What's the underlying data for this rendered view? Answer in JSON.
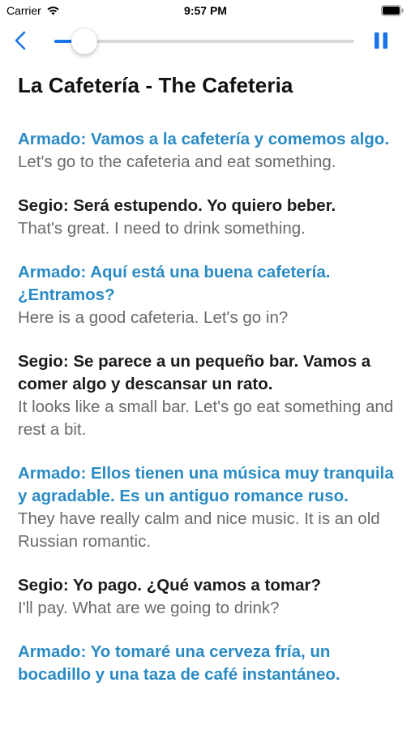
{
  "status_bar": {
    "carrier": "Carrier",
    "time": "9:57 PM",
    "wifi_icon": "wifi-icon",
    "battery_icon": "battery-icon"
  },
  "player": {
    "back_icon": "chevron-left-icon",
    "pause_icon": "pause-icon",
    "progress": 0.1,
    "accent_color": "#1a73e8"
  },
  "title": "La Cafetería - The Cafeteria",
  "colors": {
    "armado": "#2a8bc4",
    "segio": "#1c1c1c",
    "translation": "#6a6a6a"
  },
  "dialogue": [
    {
      "speaker": "armado",
      "spanish": "Armado: Vamos a la cafetería y comemos algo.",
      "english": "Let's go to the cafeteria and eat something."
    },
    {
      "speaker": "segio",
      "spanish": "Segio: Será estupendo. Yo quiero beber.",
      "english": "That's great. I need to drink something."
    },
    {
      "speaker": "armado",
      "spanish": "Armado: Aquí está una buena cafetería. ¿Entramos?",
      "english": "Here is a good cafeteria. Let's go in?"
    },
    {
      "speaker": "segio",
      "spanish": "Segio: Se parece a un pequeño bar. Vamos a comer algo y descansar un rato.",
      "english": "It looks like a small bar. Let's go eat something and rest a bit."
    },
    {
      "speaker": "armado",
      "spanish": "Armado: Ellos tienen una música muy tranquila y agradable. Es un antiguo romance ruso.",
      "english": "They have really calm and nice music. It is an old Russian romantic."
    },
    {
      "speaker": "segio",
      "spanish": "Segio: Yo pago. ¿Qué vamos a tomar?",
      "english": "I'll pay. What are we going to drink?"
    },
    {
      "speaker": "armado",
      "spanish": "Armado: Yo tomaré una cerveza fría, un bocadillo y una taza de café instantáneo.",
      "english": ""
    }
  ]
}
